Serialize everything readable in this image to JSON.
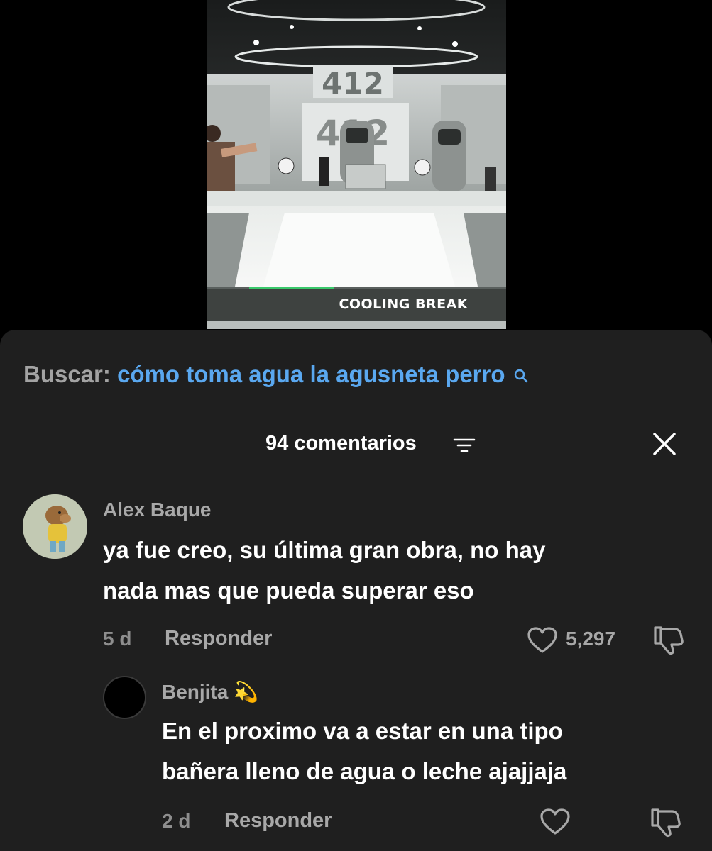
{
  "video": {
    "banner_text": "COOLING BREAK",
    "studio_sign": "412"
  },
  "search": {
    "prefix": "Buscar:",
    "query": "cómo toma agua la agusneta perro"
  },
  "comments_header": {
    "count_label": "94 comentarios"
  },
  "comments": [
    {
      "author": "Alex Baque",
      "text_line1": "ya fue creo, su última gran obra, no hay",
      "text_line2": "nada mas que pueda superar eso",
      "time": "5 d",
      "reply_label": "Responder",
      "likes": "5,297"
    },
    {
      "author": "Benjita",
      "author_emoji": "💫",
      "text_line1": "En el proximo va a estar en una tipo",
      "text_line2": "bañera lleno de agua o leche ajajjaja",
      "time": "2 d",
      "reply_label": "Responder",
      "likes": ""
    }
  ],
  "colors": {
    "sheet_bg": "#1f1f1f",
    "search_link": "#5aa8f0",
    "muted_text": "#a8a8a8",
    "primary_text": "#ffffff"
  }
}
